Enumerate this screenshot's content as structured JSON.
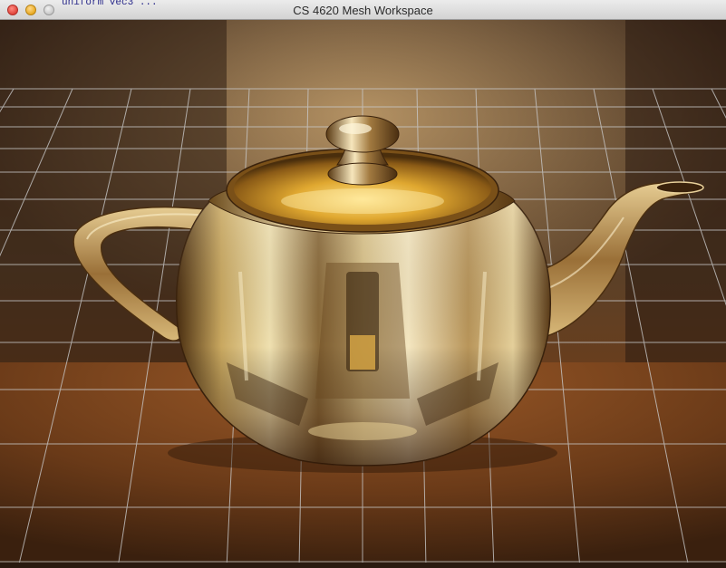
{
  "window": {
    "title": "CS 4620 Mesh Workspace",
    "stray_text": "uniform vec3 ..."
  },
  "colors": {
    "titlebar_top": "#ececec",
    "titlebar_bottom": "#d3d3d3",
    "grid_line": "#c8c8c8",
    "gold_light": "#f3d98a",
    "gold_mid": "#c89a3a",
    "gold_dark": "#5a3a12",
    "floor": "#7a4a22",
    "backdrop": "#4a3424"
  },
  "icons": [
    "close-icon",
    "minimize-icon",
    "zoom-icon"
  ]
}
